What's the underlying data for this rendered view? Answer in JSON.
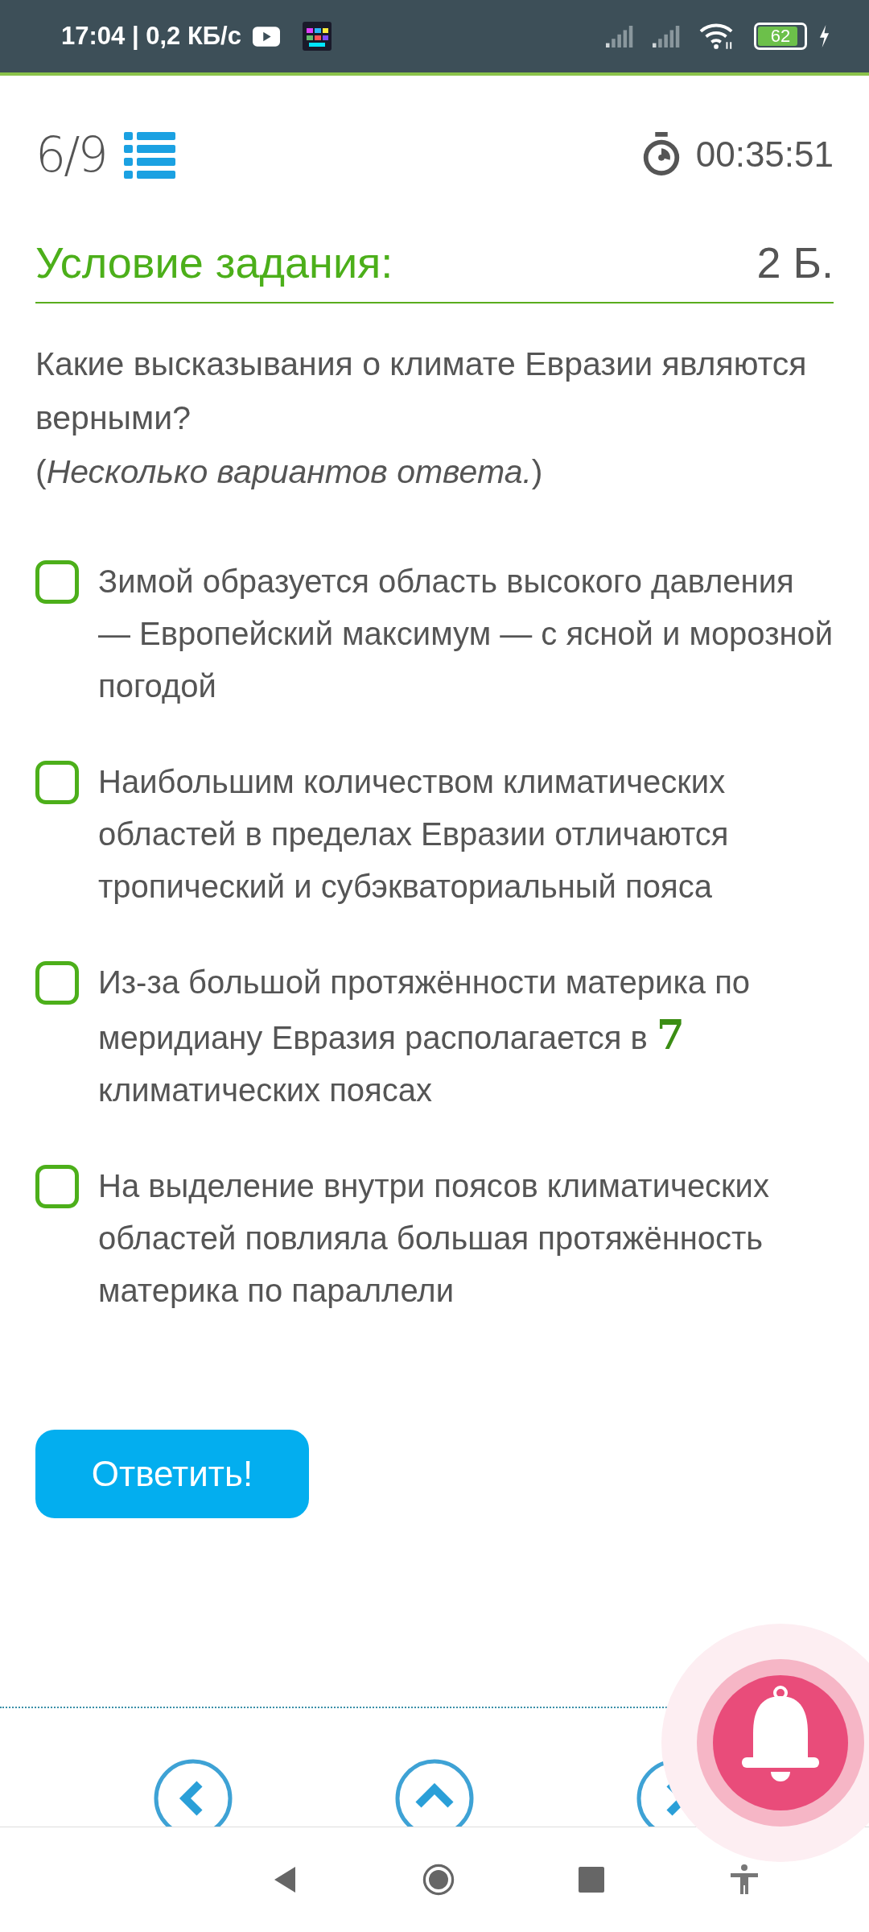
{
  "status_bar": {
    "time": "17:04 | 0,2 КБ/с",
    "battery": "62"
  },
  "header": {
    "progress": "6/9",
    "timer": "00:35:51"
  },
  "task": {
    "title": "Условие задания:",
    "points": "2 Б."
  },
  "question": {
    "text": "Какие высказывания о климате Евразии являются верными?",
    "note": "(*Несколько вариантов ответа.*)"
  },
  "options": [
    {
      "text": "Зимой образуется область высокого давления — Европейский максимум — с ясной и морозной погодой",
      "checked": false
    },
    {
      "text": "Наибольшим количеством климатических областей в пределах Евразии отличаются тропический и субэкваториальный пояса",
      "checked": false
    },
    {
      "text": "Из-за большой протяжённости материка по меридиану Евразия располагается в **7** климатических поясах",
      "checked": false
    },
    {
      "text": "На выделение внутри поясов климатических областей повлияла большая протяжённость материка по параллели",
      "checked": false
    }
  ],
  "submit_button": "Ответить!"
}
